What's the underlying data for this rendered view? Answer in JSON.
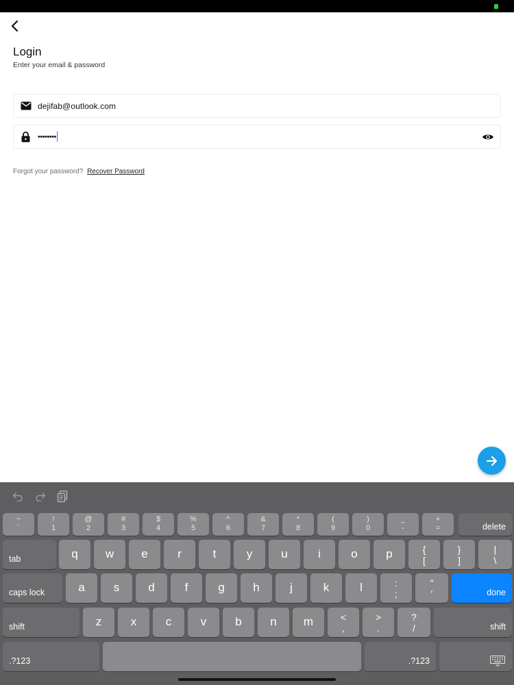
{
  "header": {
    "back_icon": "chevron-left-icon",
    "title": "Login",
    "subtitle": "Enter your email & password"
  },
  "form": {
    "email": {
      "icon": "mail-icon",
      "value": "dejifab@outlook.com"
    },
    "password": {
      "icon": "lock-icon",
      "masked_value": "••••••••",
      "toggle_icon": "eye-icon"
    },
    "forgot_text": "Forgot your password?",
    "recover_link": "Recover Password"
  },
  "next_button": {
    "icon": "arrow-right-icon",
    "color": "#1a9fe8"
  },
  "keyboard": {
    "toolbar": [
      "undo-icon",
      "redo-icon",
      "clipboard-icon"
    ],
    "number_row": [
      {
        "top": "~",
        "bottom": "`"
      },
      {
        "top": "!",
        "bottom": "1"
      },
      {
        "top": "@",
        "bottom": "2"
      },
      {
        "top": "#",
        "bottom": "3"
      },
      {
        "top": "$",
        "bottom": "4"
      },
      {
        "top": "%",
        "bottom": "5"
      },
      {
        "top": "^",
        "bottom": "6"
      },
      {
        "top": "&",
        "bottom": "7"
      },
      {
        "top": "*",
        "bottom": "8"
      },
      {
        "top": "(",
        "bottom": "9"
      },
      {
        "top": ")",
        "bottom": "0"
      },
      {
        "top": "_",
        "bottom": "-"
      },
      {
        "top": "+",
        "bottom": "="
      }
    ],
    "delete_label": "delete",
    "tab_label": "tab",
    "row_q": [
      "q",
      "w",
      "e",
      "r",
      "t",
      "y",
      "u",
      "i",
      "o",
      "p"
    ],
    "row_q_dual": [
      {
        "top": "{",
        "bottom": "["
      },
      {
        "top": "}",
        "bottom": "]"
      },
      {
        "top": "|",
        "bottom": "\\"
      }
    ],
    "caps_lock_label": "caps lock",
    "row_a": [
      "a",
      "s",
      "d",
      "f",
      "g",
      "h",
      "j",
      "k",
      "l"
    ],
    "row_a_dual": [
      {
        "top": ":",
        "bottom": ";"
      },
      {
        "top": "\"",
        "bottom": "'"
      }
    ],
    "done_label": "done",
    "shift_label": "shift",
    "row_z": [
      "z",
      "x",
      "c",
      "v",
      "b",
      "n",
      "m"
    ],
    "row_z_dual": [
      {
        "top": "<",
        "bottom": ","
      },
      {
        "top": ">",
        "bottom": "."
      },
      {
        "top": "?",
        "bottom": "/"
      }
    ],
    "symbols_label": ".?123",
    "dismiss_icon": "keyboard-dismiss-icon",
    "accent_color": "#0a84ff"
  }
}
